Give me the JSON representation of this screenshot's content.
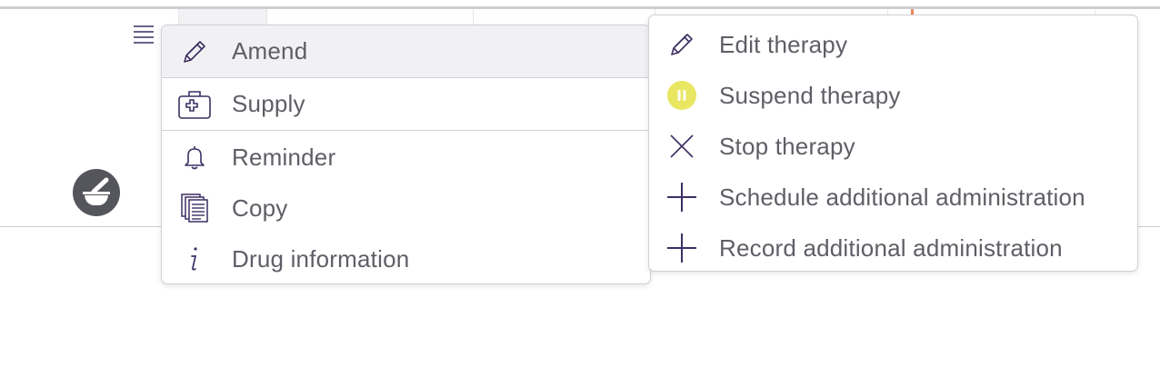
{
  "colors": {
    "accent_icon": "#3c2f63",
    "suspend_yellow": "#e9e662",
    "menu_border": "#d0d0d6",
    "hover_bg": "#f1f1f3",
    "timeline_marker": "#e8875b"
  },
  "row": {
    "menu_icon": "hamburger-icon",
    "badge_icon": "mortar-pestle-icon"
  },
  "left_menu": {
    "items": [
      {
        "label": "Amend",
        "icon": "pencil-icon"
      },
      {
        "label": "Supply",
        "icon": "medical-kit-icon"
      },
      {
        "label": "Reminder",
        "icon": "bell-icon"
      },
      {
        "label": "Copy",
        "icon": "copy-documents-icon"
      },
      {
        "label": "Drug information",
        "icon": "info-icon"
      }
    ]
  },
  "right_menu": {
    "items": [
      {
        "label": "Edit therapy",
        "icon": "pencil-icon"
      },
      {
        "label": "Suspend therapy",
        "icon": "pause-icon"
      },
      {
        "label": "Stop therapy",
        "icon": "close-icon"
      },
      {
        "label": "Schedule additional administration",
        "icon": "plus-icon"
      },
      {
        "label": "Record additional administration",
        "icon": "plus-icon"
      }
    ]
  }
}
